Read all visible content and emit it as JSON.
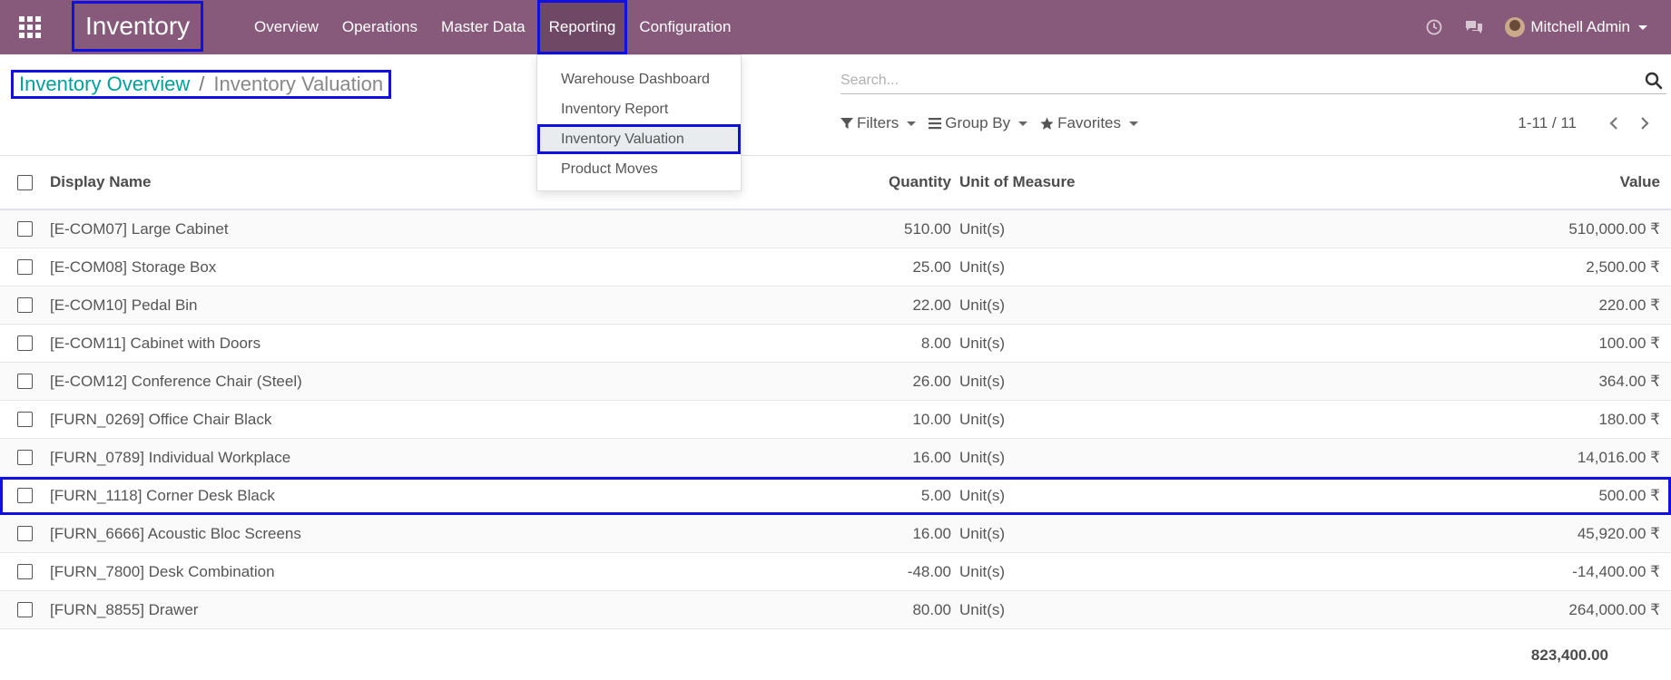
{
  "navbar": {
    "app_name": "Inventory",
    "menu": [
      "Overview",
      "Operations",
      "Master Data",
      "Reporting",
      "Configuration"
    ],
    "user": "Mitchell Admin"
  },
  "reporting_menu": [
    "Warehouse Dashboard",
    "Inventory Report",
    "Inventory Valuation",
    "Product Moves"
  ],
  "breadcrumb": {
    "parent": "Inventory Overview",
    "separator": "/",
    "current": "Inventory Valuation"
  },
  "search": {
    "placeholder": "Search..."
  },
  "filters": {
    "filters_label": "Filters",
    "group_by_label": "Group By",
    "favorites_label": "Favorites"
  },
  "pager": {
    "value": "1-11 / 11"
  },
  "table": {
    "headers": {
      "name": "Display Name",
      "quantity": "Quantity",
      "uom": "Unit of Measure",
      "value": "Value"
    },
    "rows": [
      {
        "name": "[E-COM07] Large Cabinet",
        "quantity": "510.00",
        "uom": "Unit(s)",
        "value": "510,000.00 ₹"
      },
      {
        "name": "[E-COM08] Storage Box",
        "quantity": "25.00",
        "uom": "Unit(s)",
        "value": "2,500.00 ₹"
      },
      {
        "name": "[E-COM10] Pedal Bin",
        "quantity": "22.00",
        "uom": "Unit(s)",
        "value": "220.00 ₹"
      },
      {
        "name": "[E-COM11] Cabinet with Doors",
        "quantity": "8.00",
        "uom": "Unit(s)",
        "value": "100.00 ₹"
      },
      {
        "name": "[E-COM12] Conference Chair (Steel)",
        "quantity": "26.00",
        "uom": "Unit(s)",
        "value": "364.00 ₹"
      },
      {
        "name": "[FURN_0269] Office Chair Black",
        "quantity": "10.00",
        "uom": "Unit(s)",
        "value": "180.00 ₹"
      },
      {
        "name": "[FURN_0789] Individual Workplace",
        "quantity": "16.00",
        "uom": "Unit(s)",
        "value": "14,016.00 ₹"
      },
      {
        "name": "[FURN_1118] Corner Desk Black",
        "quantity": "5.00",
        "uom": "Unit(s)",
        "value": "500.00 ₹"
      },
      {
        "name": "[FURN_6666] Acoustic Bloc Screens",
        "quantity": "16.00",
        "uom": "Unit(s)",
        "value": "45,920.00 ₹"
      },
      {
        "name": "[FURN_7800] Desk Combination",
        "quantity": "-48.00",
        "uom": "Unit(s)",
        "value": "-14,400.00 ₹"
      },
      {
        "name": "[FURN_8855] Drawer",
        "quantity": "80.00",
        "uom": "Unit(s)",
        "value": "264,000.00 ₹"
      }
    ],
    "total": "823,400.00"
  }
}
